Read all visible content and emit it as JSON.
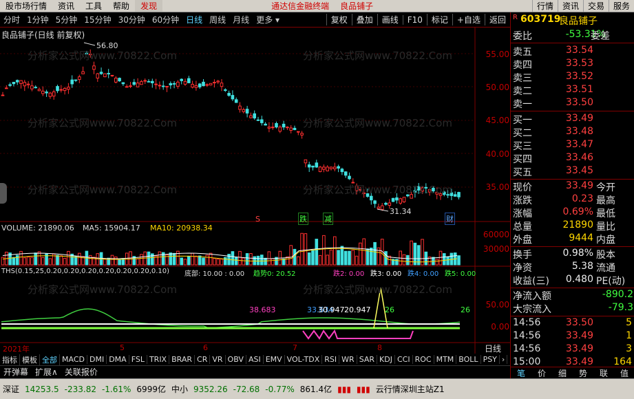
{
  "menubar": {
    "items": [
      "股市场行情",
      "资讯",
      "工具",
      "帮助"
    ],
    "discover": "发现",
    "brand": "通达信金融终端",
    "stock_name": "良品铺子",
    "right_items": [
      "行情",
      "资讯",
      "交易",
      "服务"
    ]
  },
  "toolbar": {
    "periods": [
      "分时",
      "1分钟",
      "5分钟",
      "15分钟",
      "30分钟",
      "60分钟",
      "日线",
      "周线",
      "月线",
      "更多"
    ],
    "active": "日线",
    "buttons": [
      "复权",
      "叠加",
      "画线",
      "F10",
      "标记",
      "+自选",
      "返回"
    ]
  },
  "chart": {
    "title": "良品铺子(日线 前复权)",
    "high_label": "56.80",
    "low_label": "31.34",
    "price_ticks": [
      "55.00",
      "50.00",
      "45.00",
      "40.00",
      "35.00"
    ],
    "markers": [
      "S",
      "跌",
      "减",
      "财"
    ],
    "volume_line": "VOLUME: 21890.06",
    "ma5": "MA5: 15904.17",
    "ma10": "MA10: 20938.34",
    "vol_ticks": [
      "60000",
      "30000"
    ],
    "ths_line": "THS(0.15,25,0.20,0.20,0.20,0.20,0.20,0.20,0.10)",
    "ths_bottom": "底部: 10.00 : 0.00",
    "ths_trend": "趋势0: 20.52",
    "ths_down2": "跌2: 0.00",
    "ths_down3": "跌3: 0.00",
    "ths_down4": "跌4: 0.00",
    "ths_down5": "跌5: 0.00",
    "ind_ticks": [
      "50.00",
      "0.00"
    ],
    "ind_values": [
      "38.683",
      "33.634",
      "30.947",
      "20.947",
      "26",
      "26"
    ],
    "time_labels": [
      "2021年",
      "5",
      "6",
      "7",
      "8"
    ],
    "period_label": "日线"
  },
  "bottom_tabs": [
    "指标",
    "模板",
    "全部",
    "MACD",
    "DMI",
    "DMA",
    "FSL",
    "TRIX",
    "BRAR",
    "CR",
    "VR",
    "OBV",
    "ASI",
    "EMV",
    "VOL-TDX",
    "RSI",
    "WR",
    "SAR",
    "KDJ",
    "CCI",
    "ROC",
    "MTM",
    "BOLL",
    "PSY"
  ],
  "footer": [
    "开弹幕",
    "扩展∧",
    "关联报价"
  ],
  "right_panel": {
    "code": "603719",
    "name": "良品铺子",
    "webi": "委比",
    "webi_val": "-53.31%",
    "weicha": "委差",
    "sells": [
      {
        "label": "卖五",
        "price": "33.54"
      },
      {
        "label": "卖四",
        "price": "33.53"
      },
      {
        "label": "卖三",
        "price": "33.52"
      },
      {
        "label": "卖二",
        "price": "33.51"
      },
      {
        "label": "卖一",
        "price": "33.50"
      }
    ],
    "buys": [
      {
        "label": "买一",
        "price": "33.49"
      },
      {
        "label": "买二",
        "price": "33.48"
      },
      {
        "label": "买三",
        "price": "33.47"
      },
      {
        "label": "买四",
        "price": "33.46"
      },
      {
        "label": "买五",
        "price": "33.45"
      }
    ],
    "stats": [
      {
        "l": "现价",
        "v": "33.49",
        "r": "今开"
      },
      {
        "l": "涨跌",
        "v": "0.23",
        "r": "最高"
      },
      {
        "l": "涨幅",
        "v": "0.69%",
        "r": "最低"
      },
      {
        "l": "总量",
        "v": "21890",
        "r": "量比"
      },
      {
        "l": "外盘",
        "v": "9444",
        "r": "内盘"
      },
      {
        "l": "换手",
        "v": "0.98%",
        "r": "股本"
      },
      {
        "l": "净资",
        "v": "5.38",
        "r": "流通"
      },
      {
        "l": "收益(三)",
        "v": "0.480",
        "r": "PE(动)"
      }
    ],
    "flow_in": "净流入额",
    "flow_in_val": "-890.2",
    "big_flow": "大宗流入",
    "big_flow_val": "-79.3",
    "ticks": [
      {
        "t": "14:56",
        "p": "33.50",
        "v": "5"
      },
      {
        "t": "14:56",
        "p": "33.49",
        "v": "1"
      },
      {
        "t": "14:56",
        "p": "33.49",
        "v": "3"
      },
      {
        "t": "15:00",
        "p": "33.49",
        "v": "164"
      }
    ],
    "bottom_tabs": [
      "笔",
      "价",
      "细",
      "势",
      "联",
      "值"
    ]
  },
  "statusbar": {
    "sz_label": "深证",
    "sz_value": "14253.5",
    "sz_change": "-233.82",
    "sz_pct": "-1.61%",
    "sz_amount": "6999亿",
    "zx_label": "中小",
    "zx_value": "9352.26",
    "zx_change": "-72.68",
    "zx_pct": "-0.77%",
    "zx_amount": "861.4亿",
    "server": "云行情深圳主站Z1"
  },
  "watermark": "分析家公式网www.70822.Com"
}
